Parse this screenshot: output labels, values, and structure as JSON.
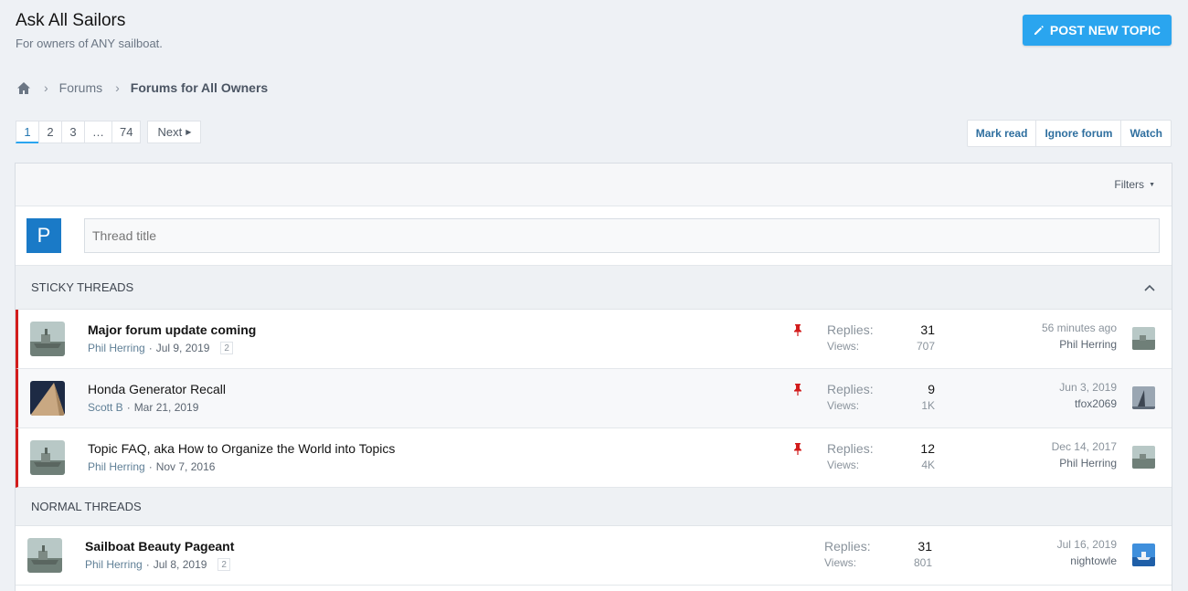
{
  "header": {
    "title": "Ask All Sailors",
    "description": "For owners of ANY sailboat.",
    "post_button": "POST NEW TOPIC"
  },
  "breadcrumb": {
    "home_icon": "home-icon",
    "items": [
      "Forums",
      "Forums for All Owners"
    ]
  },
  "pagination": {
    "pages": [
      "1",
      "2",
      "3",
      "…",
      "74"
    ],
    "current": "1",
    "next": "Next"
  },
  "actions": {
    "mark_read": "Mark read",
    "ignore_forum": "Ignore forum",
    "watch": "Watch"
  },
  "filters": {
    "label": "Filters"
  },
  "quick_thread": {
    "avatar_letter": "P",
    "placeholder": "Thread title"
  },
  "sections": {
    "sticky": "STICKY THREADS",
    "normal": "NORMAL THREADS"
  },
  "threads": [
    {
      "title": "Major forum update coming",
      "author": "Phil Herring",
      "date": "Jul 9, 2019",
      "pages": "2",
      "replies_label": "Replies:",
      "replies": "31",
      "views_label": "Views:",
      "views": "707",
      "last_date": "56 minutes ago",
      "last_user": "Phil Herring"
    },
    {
      "title": "Honda Generator Recall",
      "author": "Scott B",
      "date": "Mar 21, 2019",
      "replies_label": "Replies:",
      "replies": "9",
      "views_label": "Views:",
      "views": "1K",
      "last_date": "Jun 3, 2019",
      "last_user": "tfox2069"
    },
    {
      "title": "Topic FAQ, aka How to Organize the World into Topics",
      "author": "Phil Herring",
      "date": "Nov 7, 2016",
      "replies_label": "Replies:",
      "replies": "12",
      "views_label": "Views:",
      "views": "4K",
      "last_date": "Dec 14, 2017",
      "last_user": "Phil Herring"
    },
    {
      "title": "Sailboat Beauty Pageant",
      "author": "Phil Herring",
      "date": "Jul 8, 2019",
      "pages": "2",
      "replies_label": "Replies:",
      "replies": "31",
      "views_label": "Views:",
      "views": "801",
      "last_date": "Jul 16, 2019",
      "last_user": "nightowle"
    }
  ],
  "colors": {
    "accent": "#2aa5ef",
    "sticky_marker": "#d21c1c",
    "link": "#2f6f9f"
  }
}
